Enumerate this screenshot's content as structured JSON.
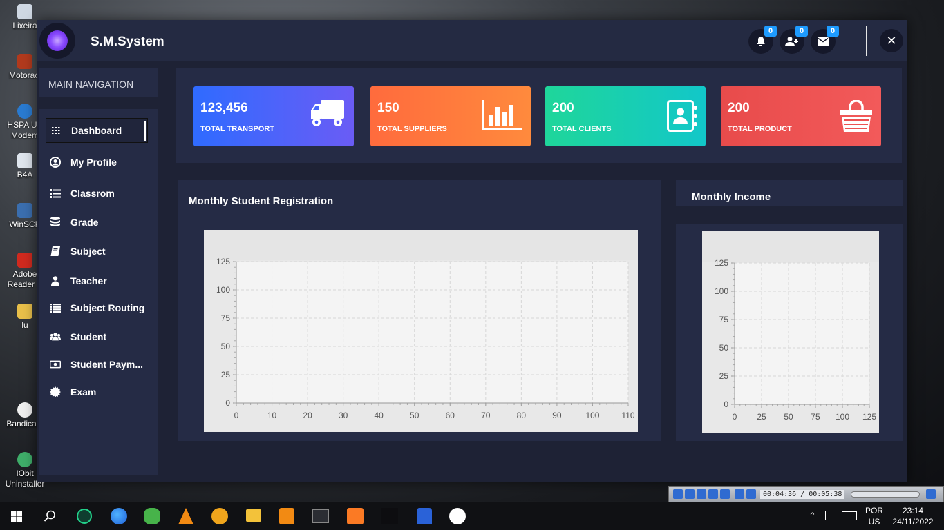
{
  "desktop": {
    "icons": [
      "Lixeira",
      "Motoraci",
      "HSPA US Modem",
      "B4A",
      "WinSCP",
      "Adobe Reader X",
      "lu",
      "Bandicam",
      "IObit Uninstaller"
    ]
  },
  "app": {
    "title": "S.M.System",
    "notifications_count": "0",
    "users_count": "0",
    "messages_count": "0",
    "close_glyph": "✕"
  },
  "sidebar": {
    "header": "MAIN NAVIGATION",
    "items": [
      {
        "label": "Dashboard",
        "icon": "grid-icon"
      },
      {
        "label": "My Profile",
        "icon": "user-circle-icon"
      },
      {
        "label": "Classrom",
        "icon": "list-icon"
      },
      {
        "label": "Grade",
        "icon": "database-icon"
      },
      {
        "label": "Subject",
        "icon": "book-icon"
      },
      {
        "label": "Teacher",
        "icon": "person-icon"
      },
      {
        "label": "Subject Routing",
        "icon": "table-list-icon"
      },
      {
        "label": "Student",
        "icon": "users-icon"
      },
      {
        "label": "Student Paym...",
        "icon": "money-bill-icon"
      },
      {
        "label": "Exam",
        "icon": "gear-cog-icon"
      }
    ]
  },
  "stats": [
    {
      "value": "123,456",
      "label": "TOTAL TRANSPORT",
      "icon": "truck-icon",
      "from": "#2f6bff",
      "to": "#6a5cf5"
    },
    {
      "value": "150",
      "label": "TOTAL SUPPLIERS",
      "icon": "bar-chart-icon",
      "from": "#ff6b3d",
      "to": "#ff8a3d"
    },
    {
      "value": "200",
      "label": "TOTAL CLIENTS",
      "icon": "contact-book-icon",
      "from": "#1fd69a",
      "to": "#12c7c9"
    },
    {
      "value": "200",
      "label": "TOTAL PRODUCT",
      "icon": "shopping-bag-icon",
      "from": "#e84b4b",
      "to": "#f25a5a"
    }
  ],
  "chart_data": [
    {
      "type": "line",
      "title": "Monthly Student Registration",
      "xlabel": "",
      "ylabel": "",
      "x_ticks": [
        0,
        10,
        20,
        30,
        40,
        50,
        60,
        70,
        80,
        90,
        100,
        110
      ],
      "y_ticks": [
        0,
        25,
        50,
        75,
        100,
        125
      ],
      "xlim": [
        0,
        110
      ],
      "ylim": [
        0,
        125
      ],
      "grid": true,
      "series": []
    },
    {
      "type": "line",
      "title": "Monthly Income",
      "xlabel": "",
      "ylabel": "",
      "x_ticks": [
        0,
        25,
        50,
        75,
        100,
        125
      ],
      "y_ticks": [
        0,
        25,
        50,
        75,
        100,
        125
      ],
      "xlim": [
        0,
        125
      ],
      "ylim": [
        0,
        125
      ],
      "grid": true,
      "series": []
    }
  ],
  "taskbar": {
    "language": "POR",
    "layout": "US",
    "time": "23:14",
    "date": "24/11/2022",
    "player_time": "00:04:36 / 00:05:38"
  }
}
